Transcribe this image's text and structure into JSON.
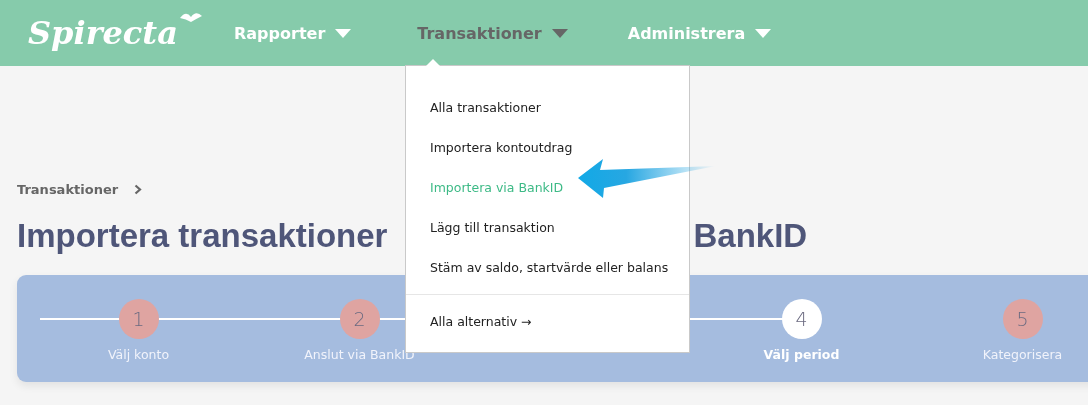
{
  "logo": "Spirecta",
  "nav": [
    {
      "label": "Rapporter",
      "selected": false
    },
    {
      "label": "Transaktioner",
      "selected": true
    },
    {
      "label": "Administrera",
      "selected": false
    }
  ],
  "breadcrumb": [
    "Transaktioner"
  ],
  "title_start": "Importera transaktioner",
  "title_end": "BankID",
  "steps": [
    {
      "number": "1",
      "label": "Välj konto",
      "selected": false
    },
    {
      "number": "2",
      "label": "Anslut via BankID",
      "selected": false
    },
    {
      "selected": false
    },
    {
      "number": "4",
      "label": "Välj period",
      "selected": true
    },
    {
      "number": "5",
      "label": "Kategorisera",
      "selected": false
    }
  ],
  "menu": {
    "items": [
      {
        "label": "Alla transaktioner",
        "selected": false
      },
      {
        "label": "Importera kontoutdrag",
        "selected": false
      },
      {
        "label": "Importera via BankID",
        "selected": true
      },
      {
        "label": "Lägg till transaktion",
        "selected": false
      },
      {
        "label": "Stäm av saldo, startvärde eller balans",
        "selected": false
      }
    ],
    "footer": "Alla alternativ →"
  }
}
